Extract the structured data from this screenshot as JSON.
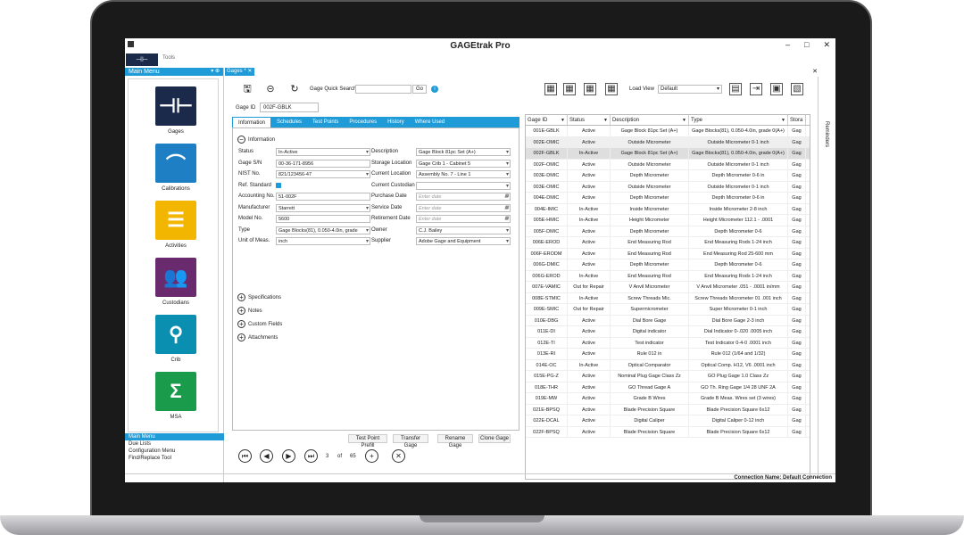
{
  "window": {
    "title": "GAGEtrak Pro",
    "minimize": "–",
    "maximize": "□",
    "close": "✕"
  },
  "ribbon": {
    "logo": "⊣⊢",
    "tools_tab": "Tools"
  },
  "main_menu": {
    "header": "Main Menu",
    "pin": "▾ ⊕",
    "tiles": [
      {
        "label": "Gages",
        "color": "#1b2a4a",
        "glyph": "⊣⊢"
      },
      {
        "label": "Calibrations",
        "color": "#1f7fc4",
        "glyph": "⌒"
      },
      {
        "label": "Activities",
        "color": "#f2b600",
        "glyph": "☰"
      },
      {
        "label": "Custodians",
        "color": "#6a2a6e",
        "glyph": "👥"
      },
      {
        "label": "Crib",
        "color": "#0b8fb0",
        "glyph": "⚲"
      },
      {
        "label": "MSA",
        "color": "#1a9b4b",
        "glyph": "Σ"
      }
    ],
    "links": [
      "Main Menu",
      "Due Lists",
      "Configuration Menu",
      "Find/Replace Tool"
    ]
  },
  "doc_tab": {
    "label": "Gages *",
    "close": "✕"
  },
  "doc_close": "✕",
  "toolbar": {
    "save_icon": "🖫",
    "back_icon": "⊝",
    "refresh_icon": "↻",
    "quick_search_label": "Gage Quick Search",
    "quick_search_value": "",
    "go_label": "Go",
    "help": "i"
  },
  "gage_id": {
    "label": "Gage ID",
    "value": "002F-GBLK"
  },
  "tabs": [
    "Information",
    "Schedules",
    "Test Points",
    "Procedures",
    "History",
    "Where Used"
  ],
  "information": {
    "section_label": "Information",
    "toggle": "−",
    "left_fields": [
      {
        "label": "Status",
        "value": "In-Active",
        "kind": "dd"
      },
      {
        "label": "Gage S/N",
        "value": "00-36-171-8956",
        "kind": "text"
      },
      {
        "label": "NIST No.",
        "value": "821/123456-47",
        "kind": "dd"
      },
      {
        "label": "Ref. Standard",
        "value": "",
        "kind": "check"
      },
      {
        "label": "Accounting No.",
        "value": "51-002F",
        "kind": "text"
      },
      {
        "label": "Manufacturer",
        "value": "Starrett",
        "kind": "dd"
      },
      {
        "label": "Model No.",
        "value": "5600",
        "kind": "text"
      },
      {
        "label": "Type",
        "value": "Gage Blocks(81), 0.050-4.0in, grade",
        "kind": "dd"
      },
      {
        "label": "Unit of Meas.",
        "value": "inch",
        "kind": "dd"
      }
    ],
    "right_fields": [
      {
        "label": "Description",
        "value": "Gage Block  81pc Set (A+)",
        "kind": "dd"
      },
      {
        "label": "Storage Location",
        "value": "Gage Crib 1 - Cabinet 5",
        "kind": "dd"
      },
      {
        "label": "Current Location",
        "value": "Assembly No. 7 - Line 1",
        "kind": "dd"
      },
      {
        "label": "Current Custodian",
        "value": "",
        "kind": "dd"
      },
      {
        "label": "Purchase Date",
        "value": "Enter date",
        "kind": "dt"
      },
      {
        "label": "Service Date",
        "value": "Enter date",
        "kind": "dt"
      },
      {
        "label": "Retirement Date",
        "value": "Enter date",
        "kind": "dt"
      },
      {
        "label": "Owner",
        "value": "C.J. Bailey",
        "kind": "dd"
      },
      {
        "label": "Supplier",
        "value": "Adobe Gage and Equipment",
        "kind": "dd"
      }
    ],
    "collapsed_sections": [
      "Specifications",
      "Notes",
      "Custom Fields",
      "Attachments"
    ],
    "expand": "+"
  },
  "actions": [
    "Test Point Prefill",
    "Transfer Gage",
    "Rename Gage",
    "Clone Gage"
  ],
  "navigation": {
    "first": "⏮",
    "prev": "◀",
    "next": "▶",
    "last": "⏭",
    "current": "3",
    "of": "of",
    "total": "65",
    "add": "+",
    "delete": "✕"
  },
  "grid_toolbar": {
    "view_icons": [
      "▦",
      "▦",
      "▦",
      "▦"
    ],
    "load_view_label": "Load View",
    "load_view_value": "Default",
    "export_icons": [
      "▤",
      "⇥",
      "▣",
      "▧"
    ]
  },
  "grid": {
    "columns": [
      "Gage ID",
      "Status",
      "Description",
      "Type",
      "Stora"
    ],
    "filter_icon": "▼",
    "rows": [
      [
        "001E-GBLK",
        "Active",
        "Gage Block  81pc Set (A+)",
        "Gage Blocks(81), 0.050-4.0in, grade 0(A+)",
        "Gag"
      ],
      [
        "002E-OMIC",
        "Active",
        "Outside Micrometer",
        "Outside Micrometer 0-1 inch",
        "Gag"
      ],
      [
        "002F-GBLK",
        "In-Active",
        "Gage Block  81pc Set (A+)",
        "Gage Blocks(81), 0.050-4.0in, grade 0(A+)",
        "Gag"
      ],
      [
        "002F-OMIC",
        "Active",
        "Outside Micrometer",
        "Outside Micrometer 0-1 inch",
        "Gag"
      ],
      [
        "003E-DMIC",
        "Active",
        "Depth Micrometer",
        "Depth Micrometer 0-6 in",
        "Gag"
      ],
      [
        "003E-OMIC",
        "Active",
        "Outside Micrometer",
        "Outside Micrometer 0-1 inch",
        "Gag"
      ],
      [
        "004E-DMIC",
        "Active",
        "Depth Micrometer",
        "Depth Micrometer 0-6 in",
        "Gag"
      ],
      [
        "004E-IMIC",
        "In-Active",
        "Inside Micrometer",
        "Inside Micrometer 2-8 inch",
        "Gag"
      ],
      [
        "005E-HMIC",
        "In-Active",
        "Height Micrometer",
        "Height Micrometer 112.1 - .0001",
        "Gag"
      ],
      [
        "005F-DMIC",
        "Active",
        "Depth Micrometer",
        "Depth Micrometer 0-6",
        "Gag"
      ],
      [
        "006E-EROD",
        "Active",
        "End Measuring Rod",
        "End Measuring Rods 1-24 inch",
        "Gag"
      ],
      [
        "006F-ERODM",
        "Active",
        "End Measuring Rod",
        "End Measuring Rod 25-600 mm",
        "Gag"
      ],
      [
        "006G-DMIC",
        "Active",
        "Depth Micrometer",
        "Depth Micrometer 0-6",
        "Gag"
      ],
      [
        "006G-EROD",
        "In-Active",
        "End Measuring Rod",
        "End Measuring Rods 1-24 inch",
        "Gag"
      ],
      [
        "007E-VAMIC",
        "Out for Repair",
        "V Anvil Micrometer",
        "V Anvil Micrometer .051 - .0001 in/mm",
        "Gag"
      ],
      [
        "008E-STMIC",
        "In-Active",
        "Screw Threads Mic.",
        "Screw Threads Micrometer 01 .001 inch",
        "Gag"
      ],
      [
        "009E-SMIC",
        "Out for Repair",
        "Supermicrometer",
        "Super Micrometer 0-1 inch",
        "Gag"
      ],
      [
        "010E-DBG",
        "Active",
        "Dial Bore Gage",
        "Dial Bore Gage 2-3 inch",
        "Gag"
      ],
      [
        "011E-DI",
        "Active",
        "Digital indicator",
        "Dial Indicator 0-.020 .0005 inch",
        "Gag"
      ],
      [
        "012E-TI",
        "Active",
        "Test indicator",
        "Test Indicator 0-4-0 .0001 inch",
        "Gag"
      ],
      [
        "013E-RI",
        "Active",
        "Rule 012 in",
        "Rule 012  (1/64 and 1/32)",
        "Gag"
      ],
      [
        "014E-OC",
        "In-Active",
        "Optical Comparator",
        "Optical Comp. H12, V6 .0001 inch",
        "Gag"
      ],
      [
        "015E-PG-Z",
        "Active",
        "Nominal Plug Gage Class Zz",
        "GO Plug Gage 1.0 Class Zz",
        "Gag"
      ],
      [
        "018E-THR",
        "Active",
        "GO Thread Gage A",
        "GO Th. Ring Gage 1/4 28 UNF 2A",
        "Gag"
      ],
      [
        "019E-MW",
        "Active",
        "Grade B Wires",
        "Grade B Meas. Wires set (3 wires)",
        "Gag"
      ],
      [
        "021E-BPSQ",
        "Active",
        "Blade Precision Square",
        "Blade Precision Square 6x12",
        "Gag"
      ],
      [
        "022E-DCAL",
        "Active",
        "Digital Caliper",
        "Digital Caliper 0-12 inch",
        "Gag"
      ],
      [
        "022F-BPSQ",
        "Active",
        "Blade Precision Square",
        "Blade Precision Square 6x12",
        "Gag"
      ]
    ]
  },
  "reminders": "Reminders",
  "status": {
    "connection": "Connection Name: Default Connection"
  }
}
